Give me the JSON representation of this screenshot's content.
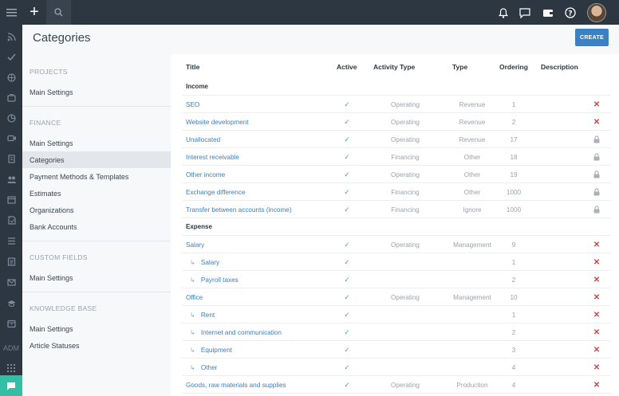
{
  "rail": {
    "icons": [
      "menu-icon",
      "rss-icon",
      "check-icon",
      "globe-icon",
      "briefcase-icon",
      "chart-icon",
      "video-icon",
      "page-icon",
      "users-icon",
      "calendar-icon",
      "contract-icon",
      "list-icon",
      "document-icon",
      "mail-icon",
      "graduation-icon",
      "archive-icon"
    ],
    "admin_label": "ADM",
    "apps_icon": "grid-icon",
    "chat_icon": "chat-icon"
  },
  "topbar": {
    "plus": "+",
    "icons": [
      "bell-icon",
      "message-icon",
      "wallet-icon",
      "help-icon"
    ]
  },
  "page": {
    "title": "Categories",
    "create_label": "CREATE"
  },
  "nav": {
    "groups": [
      {
        "label": "PROJECTS",
        "items": [
          "Main Settings"
        ]
      },
      {
        "label": "FINANCE",
        "items": [
          "Main Settings",
          "Categories",
          "Payment Methods & Templates",
          "Estimates",
          "Organizations",
          "Bank Accounts"
        ]
      },
      {
        "label": "CUSTOM FIELDS",
        "items": [
          "Main Settings"
        ]
      },
      {
        "label": "KNOWLEDGE BASE",
        "items": [
          "Main Settings",
          "Article Statuses"
        ]
      }
    ],
    "active": "Categories"
  },
  "table": {
    "headers": {
      "title": "Title",
      "active": "Active",
      "activity_type": "Activity Type",
      "type": "Type",
      "ordering": "Ordering",
      "description": "Description"
    },
    "sections": [
      {
        "label": "Income",
        "rows": [
          {
            "title": "SEO",
            "child": false,
            "activity": "Operating",
            "type": "Revenue",
            "ordering": "1",
            "action": "delete"
          },
          {
            "title": "Website development",
            "child": false,
            "activity": "Operating",
            "type": "Revenue",
            "ordering": "2",
            "action": "delete"
          },
          {
            "title": "Unallocated",
            "child": false,
            "activity": "Operating",
            "type": "Revenue",
            "ordering": "17",
            "action": "lock"
          },
          {
            "title": "Interest receivable",
            "child": false,
            "activity": "Financing",
            "type": "Other",
            "ordering": "18",
            "action": "lock"
          },
          {
            "title": "Other income",
            "child": false,
            "activity": "Operating",
            "type": "Other",
            "ordering": "19",
            "action": "lock"
          },
          {
            "title": "Exchange difference",
            "child": false,
            "activity": "Financing",
            "type": "Other",
            "ordering": "1000",
            "action": "lock"
          },
          {
            "title": "Transfer between accounts (income)",
            "child": false,
            "activity": "Financing",
            "type": "Ignore",
            "ordering": "1000",
            "action": "lock"
          }
        ]
      },
      {
        "label": "Expense",
        "rows": [
          {
            "title": "Salary",
            "child": false,
            "activity": "Operating",
            "type": "Management",
            "ordering": "9",
            "action": "delete"
          },
          {
            "title": "Salary",
            "child": true,
            "activity": "",
            "type": "",
            "ordering": "1",
            "action": "delete"
          },
          {
            "title": "Payroll taxes",
            "child": true,
            "activity": "",
            "type": "",
            "ordering": "2",
            "action": "delete"
          },
          {
            "title": "Office",
            "child": false,
            "activity": "Operating",
            "type": "Management",
            "ordering": "10",
            "action": "delete"
          },
          {
            "title": "Rent",
            "child": true,
            "activity": "",
            "type": "",
            "ordering": "1",
            "action": "delete"
          },
          {
            "title": "Internet and communication",
            "child": true,
            "activity": "",
            "type": "",
            "ordering": "2",
            "action": "delete"
          },
          {
            "title": "Equipment",
            "child": true,
            "activity": "",
            "type": "",
            "ordering": "3",
            "action": "delete"
          },
          {
            "title": "Other",
            "child": true,
            "activity": "",
            "type": "",
            "ordering": "4",
            "action": "delete"
          },
          {
            "title": "Goods, raw materials and supplies",
            "child": false,
            "activity": "Operating",
            "type": "Production",
            "ordering": "4",
            "action": "delete"
          }
        ]
      }
    ],
    "check_symbol": "✓",
    "child_arrow": "↳",
    "delete_symbol": "✕"
  },
  "colors": {
    "rail": "#2d3742",
    "accent": "#3a82c4",
    "link": "#3a7fc0",
    "check": "#3ab37c",
    "delete": "#d94040",
    "chat": "#33bfa6"
  }
}
